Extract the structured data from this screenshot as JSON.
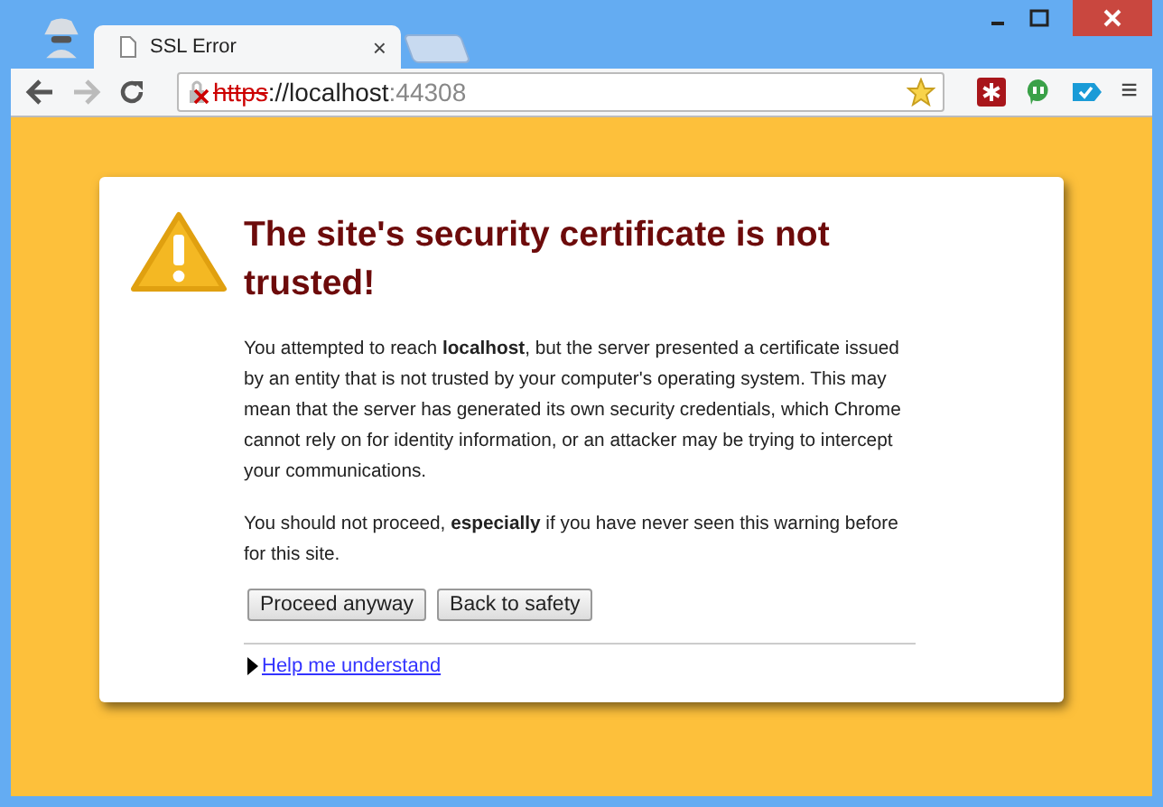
{
  "window": {
    "tabs": [
      {
        "title": "SSL Error",
        "close": "×",
        "selected": true
      }
    ]
  },
  "address_bar": {
    "scheme": "https",
    "host": "://localhost",
    "port": ":44308",
    "secure": false
  },
  "menu_glyph": "≡",
  "warning": {
    "title": "The site's security certificate is not trusted!",
    "paragraphs": [
      "You attempted to reach **localhost**, but the server presented a certificate issued by an entity that is not trusted by your computer's operating system. This may mean that the server has generated its own security credentials, which Chrome cannot rely on for identity information, or an attacker may be trying to intercept your communications.",
      "You should not proceed, **especially** if you have never seen this warning before for this site."
    ],
    "buttons": [
      "Proceed anyway",
      "Back to safety"
    ],
    "help_link": {
      "label": "Help me understand",
      "expanded": false
    }
  }
}
